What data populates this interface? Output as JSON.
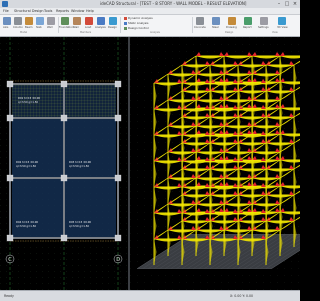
{
  "window": {
    "title": "ideCAD Structural - [TEST - 8 STORY - WALL MODEL - RESULT ELEVATION]",
    "minimize": "–",
    "maximize": "□",
    "close": "×"
  },
  "menu": [
    "File",
    "Structural Design",
    "Tools",
    "Reports",
    "Window",
    "Help"
  ],
  "ribbon": {
    "buttons": [
      "Axis",
      "Column",
      "Beam",
      "Slab",
      "Wall",
      "Foundation",
      "Stair",
      "Load",
      "Analysis",
      "Design"
    ],
    "analysis_items": [
      "Dynamic Analysis",
      "Static Analysis",
      "Design Control"
    ],
    "right_buttons": [
      "Concrete",
      "Steel",
      "Drawing",
      "Report",
      "Settings",
      "3D View"
    ],
    "groups": [
      "Model",
      "Members",
      "Analysis",
      "Design",
      "View"
    ]
  },
  "slabs": [
    {
      "label": "D01 h=15 ±0.00",
      "sub": "q=3.50 g=1.50"
    },
    {
      "label": "D02 h=15 ±0.00",
      "sub": "q=3.50 g=1.50"
    },
    {
      "label": "D03 h=15 ±0.00",
      "sub": "q=3.50 g=1.50"
    },
    {
      "label": "D04 h=15 ±0.00",
      "sub": "q=3.50 g=1.50"
    },
    {
      "label": "D05 h=15 ±0.00",
      "sub": "q=3.50 g=1.50"
    }
  ],
  "axes": {
    "bottom_left": "C",
    "bottom_right": "D"
  },
  "status": {
    "left": "Ready",
    "right": "X: 0.00  Y: 0.00"
  },
  "colors": {
    "background": "#000000",
    "frame": "#f2e600",
    "moment_pos": "#e5262a",
    "moment_neg": "#f2e600",
    "slab": "#1f3f6b"
  }
}
